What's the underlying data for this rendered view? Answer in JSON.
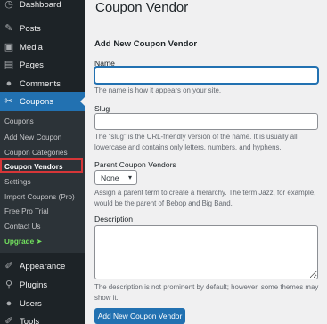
{
  "sidebar": {
    "items": [
      {
        "label": "Dashboard",
        "icon": "dashboard-icon",
        "glyph": "◷"
      },
      {
        "label": "Posts",
        "icon": "pushpin-icon",
        "glyph": "✎"
      },
      {
        "label": "Media",
        "icon": "media-icon",
        "glyph": "▣"
      },
      {
        "label": "Pages",
        "icon": "pages-icon",
        "glyph": "▤"
      },
      {
        "label": "Comments",
        "icon": "comment-icon",
        "glyph": "●"
      },
      {
        "label": "Coupons",
        "icon": "scissors-icon",
        "glyph": "✂"
      },
      {
        "label": "Appearance",
        "icon": "paintbrush-icon",
        "glyph": "✐"
      },
      {
        "label": "Plugins",
        "icon": "plugin-icon",
        "glyph": "⚲"
      },
      {
        "label": "Users",
        "icon": "users-icon",
        "glyph": "●"
      },
      {
        "label": "Tools",
        "icon": "wrench-icon",
        "glyph": "✐"
      }
    ],
    "submenu": [
      "Coupons",
      "Add New Coupon",
      "Coupon Categories",
      "Coupon Vendors",
      "Settings",
      "Import Coupons (Pro)",
      "Free Pro Trial",
      "Contact Us",
      "Upgrade ➤"
    ]
  },
  "main": {
    "page_title": "Coupon Vendor",
    "form_title": "Add New Coupon Vendor",
    "name": {
      "label": "Name",
      "value": "",
      "help": "The name is how it appears on your site."
    },
    "slug": {
      "label": "Slug",
      "value": "",
      "help": "The “slug” is the URL-friendly version of the name. It is usually all lowercase and contains only letters, numbers, and hyphens."
    },
    "parent": {
      "label": "Parent Coupon Vendors",
      "selected": "None",
      "help": "Assign a parent term to create a hierarchy. The term Jazz, for example, would be the parent of Bebop and Big Band."
    },
    "description": {
      "label": "Description",
      "value": "",
      "help": "The description is not prominent by default; however, some themes may show it."
    },
    "submit_label": "Add New Coupon Vendor"
  },
  "colors": {
    "accent": "#2271b1",
    "sidebar": "#1d2327",
    "highlight": "#d63638",
    "upgrade": "#72e15e"
  }
}
